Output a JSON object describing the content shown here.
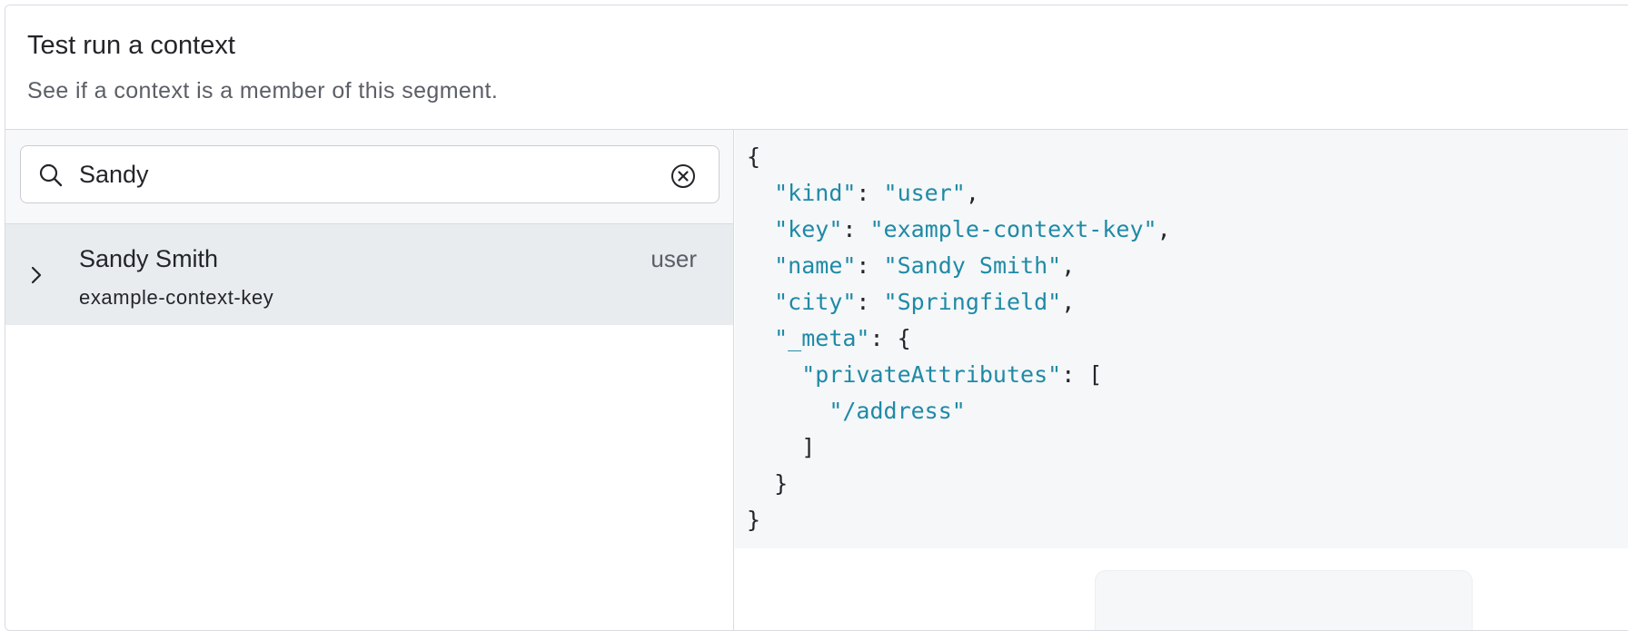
{
  "header": {
    "title": "Test run a context",
    "subtitle": "See if a context is a member of this segment."
  },
  "search": {
    "value": "Sandy",
    "icon": "search-icon",
    "clear_icon": "clear-circle-x-icon"
  },
  "results": [
    {
      "name": "Sandy Smith",
      "key": "example-context-key",
      "kind": "user",
      "expanded": false
    }
  ],
  "context_json": {
    "open_brace": "{",
    "lines": [
      {
        "key": "\"kind\"",
        "value": "\"user\"",
        "trail": ","
      },
      {
        "key": "\"key\"",
        "value": "\"example-context-key\"",
        "trail": ","
      },
      {
        "key": "\"name\"",
        "value": "\"Sandy Smith\"",
        "trail": ","
      },
      {
        "key": "\"city\"",
        "value": "\"Springfield\"",
        "trail": ","
      }
    ],
    "meta_key": "\"_meta\"",
    "private_key": "\"privateAttributes\"",
    "private_value": "\"/address\"",
    "close_bracket": "]",
    "close_inner": "}",
    "close_brace": "}"
  },
  "colors": {
    "json_string": "#1f8aa6",
    "row_selected": "#e9ecef",
    "code_bg": "#f5f7f9"
  }
}
